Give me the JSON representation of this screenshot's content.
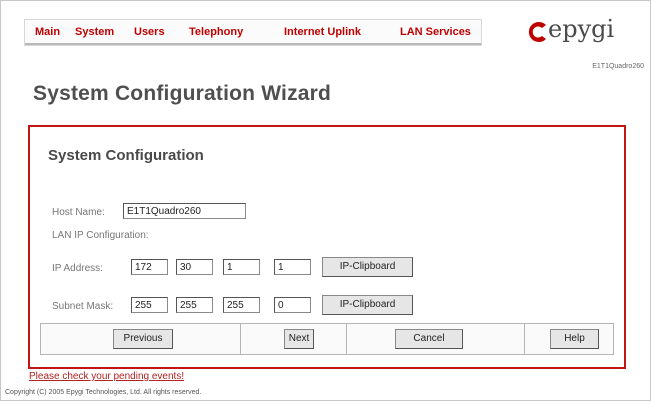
{
  "nav": {
    "items": [
      "Main",
      "System",
      "Users",
      "Telephony",
      "Internet Uplink",
      "LAN Services"
    ]
  },
  "brand": {
    "logo_text": "epygi",
    "model": "E1T1Quadro260",
    "accent": "#c00000"
  },
  "page_title": "System Configuration Wizard",
  "panel": {
    "title": "System Configuration",
    "host_name_label": "Host Name:",
    "host_name_value": "E1T1Quadro260",
    "lan_ip_label": "LAN IP Configuration:",
    "ip_address_label": "IP Address:",
    "ip_address": [
      "172",
      "30",
      "1",
      "1"
    ],
    "subnet_mask_label": "Subnet Mask:",
    "subnet_mask": [
      "255",
      "255",
      "255",
      "0"
    ],
    "clipboard_label": "IP-Clipboard"
  },
  "buttons": {
    "previous": "Previous",
    "next": "Next",
    "cancel": "Cancel",
    "help": "Help"
  },
  "footer": {
    "events_link": "Please check your pending events!",
    "copyright": "Copyright (C) 2005 Epygi Technologies, Ltd. All rights reserved."
  }
}
